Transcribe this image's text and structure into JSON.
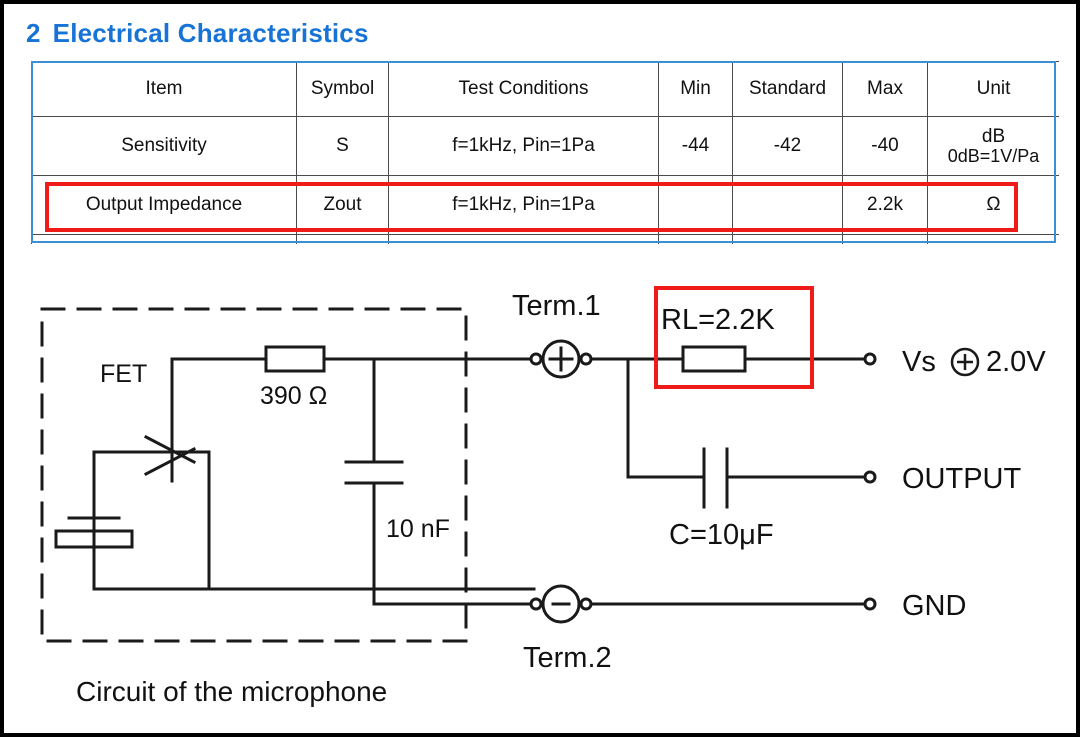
{
  "heading": {
    "number": "2",
    "title": "Electrical Characteristics"
  },
  "table": {
    "headers": [
      "Item",
      "Symbol",
      "Test Conditions",
      "Min",
      "Standard",
      "Max",
      "Unit"
    ],
    "rows": [
      {
        "item": "Sensitivity",
        "symbol": "S",
        "conditions": "f=1kHz,  Pin=1Pa",
        "min": "-44",
        "standard": "-42",
        "max": "-40",
        "unit_line1": "dB",
        "unit_line2": "0dB=1V/Pa",
        "highlighted": false
      },
      {
        "item": "Output Impedance",
        "symbol": "Zout",
        "conditions": "f=1kHz,  Pin=1Pa",
        "min": "",
        "standard": "",
        "max": "2.2k",
        "unit_line1": "Ω",
        "unit_line2": "",
        "highlighted": true
      }
    ],
    "highlight_color": "#ee1b18",
    "frame_color": "#3b8fd6"
  },
  "circuit": {
    "caption": "Circuit of the microphone",
    "labels": {
      "fet": "FET",
      "resistor_internal": "390 Ω",
      "cap_internal": "10 nF",
      "term1": "Term.1",
      "term2": "Term.2",
      "rl": "RL=2.2K",
      "coupling_cap": "C=10μF",
      "supply": "Vs",
      "supply_value": "2.0V",
      "output": "OUTPUT",
      "gnd": "GND",
      "plus": "+",
      "minus": "-"
    },
    "rl_highlight_color": "#ee1b18"
  }
}
